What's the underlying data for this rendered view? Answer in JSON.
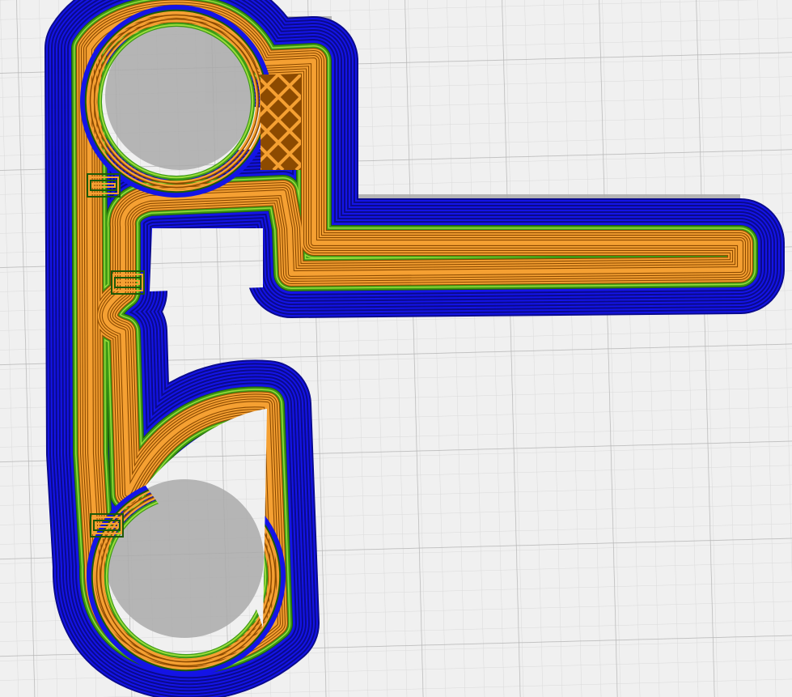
{
  "viewer": {
    "background_color": "#f0f0f0",
    "grid_minor_color": "#dadada",
    "grid_major_color": "#b4b4b4",
    "shadow_color": "#aaaaaa"
  },
  "preview": {
    "layers": [
      {
        "name": "skirt",
        "color": "#1414e6",
        "lines": 8,
        "line_color": "#0a0a8c"
      },
      {
        "name": "outer-wall",
        "color": "#3c9a14",
        "lines": 2,
        "line_color": "#1e5a08"
      },
      {
        "name": "inner-wall",
        "color": "#f5a032",
        "lines": 5,
        "line_color": "#8c4a00"
      },
      {
        "name": "infill",
        "color": "#f5a032",
        "line_color": "#8c4a00"
      },
      {
        "name": "shell-edge",
        "color": "#9adc3c"
      }
    ],
    "features": [
      "top-hole",
      "bottom-hole",
      "horizontal-arm",
      "side-clip-top",
      "side-clip-middle",
      "side-clip-bottom",
      "infill-lattice",
      "teardrop-window"
    ]
  }
}
